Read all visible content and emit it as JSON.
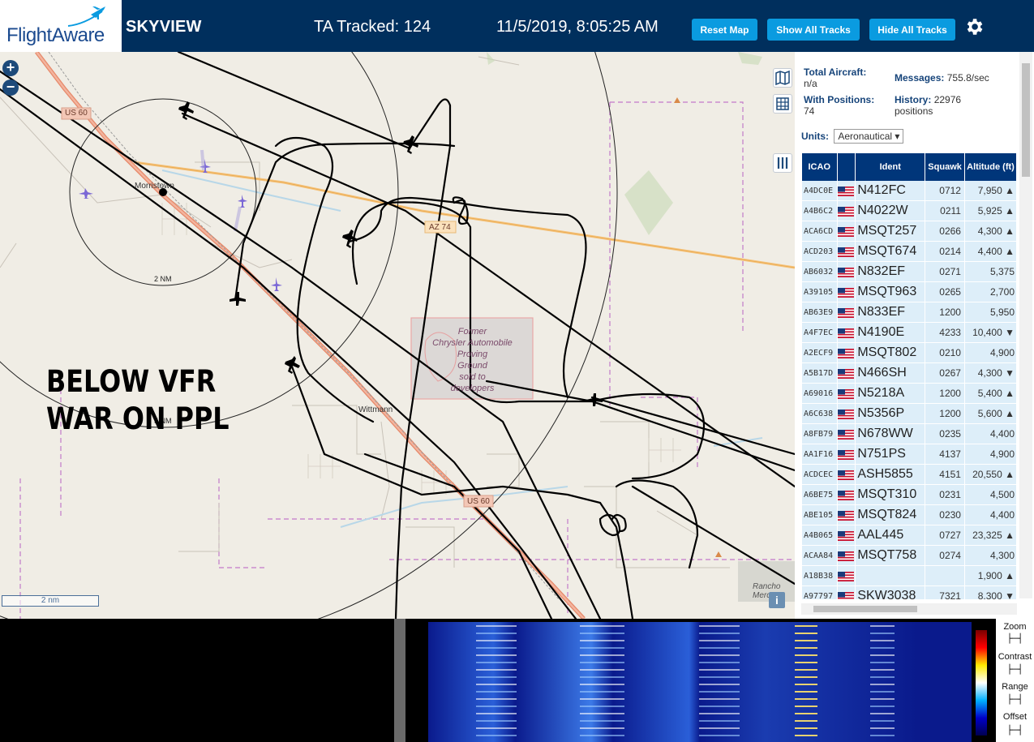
{
  "header": {
    "logo": "FlightAware",
    "app_title": "SKYVIEW",
    "ta_tracked": "TA Tracked: 124",
    "datetime": "11/5/2019, 8:05:25 AM",
    "buttons": {
      "reset_map": "Reset Map",
      "show_all": "Show All Tracks",
      "hide_all": "Hide All Tracks"
    },
    "accent_color": "#0a9be0",
    "bar_color": "#002f5d"
  },
  "map": {
    "labels": {
      "us60_top": "US 60",
      "us60_bottom": "US 60",
      "az74": "AZ 74",
      "morristown": "Morristown",
      "wittmann": "Wittmann",
      "range_2nm": "2 NM",
      "range_5nm": "5 NM",
      "proving_ground": [
        "Former",
        "Chrysler Automobile",
        "Proving",
        "Ground",
        "sold to",
        "developers"
      ],
      "rancho": [
        "Rancho",
        "Merca"
      ]
    },
    "overlay_text": [
      "BELOW VFR",
      "WAR ON PPL"
    ],
    "scale_label": "2 nm",
    "zoom_in": "+",
    "zoom_out": "−",
    "info": "i"
  },
  "sidebar": {
    "total_aircraft_label": "Total Aircraft:",
    "total_aircraft_value": "n/a",
    "with_positions_label": "With Positions:",
    "with_positions_value": "74",
    "messages_label": "Messages:",
    "messages_value": "755.8/sec",
    "history_label": "History:",
    "history_value": "22976",
    "history_unit": "positions",
    "units_label": "Units:",
    "units_value": "Aeronautical",
    "columns": [
      "ICAO",
      "",
      "Ident",
      "Squawk",
      "Altitude (ft)"
    ],
    "rows": [
      {
        "icao": "A4DC0E",
        "ident": "N412FC",
        "squawk": "0712",
        "alt": "7,950",
        "trend": "▲"
      },
      {
        "icao": "A4B6C2",
        "ident": "N4022W",
        "squawk": "0211",
        "alt": "5,925",
        "trend": "▲"
      },
      {
        "icao": "ACA6CD",
        "ident": "MSQT257",
        "squawk": "0266",
        "alt": "4,300",
        "trend": "▲"
      },
      {
        "icao": "ACD203",
        "ident": "MSQT674",
        "squawk": "0214",
        "alt": "4,400",
        "trend": "▲"
      },
      {
        "icao": "AB6032",
        "ident": "N832EF",
        "squawk": "0271",
        "alt": "5,375",
        "trend": ""
      },
      {
        "icao": "A39105",
        "ident": "MSQT963",
        "squawk": "0265",
        "alt": "2,700",
        "trend": ""
      },
      {
        "icao": "AB63E9",
        "ident": "N833EF",
        "squawk": "1200",
        "alt": "5,950",
        "trend": ""
      },
      {
        "icao": "A4F7EC",
        "ident": "N4190E",
        "squawk": "4233",
        "alt": "10,400",
        "trend": "▼"
      },
      {
        "icao": "A2ECF9",
        "ident": "MSQT802",
        "squawk": "0210",
        "alt": "4,900",
        "trend": ""
      },
      {
        "icao": "A5B17D",
        "ident": "N466SH",
        "squawk": "0267",
        "alt": "4,300",
        "trend": "▼"
      },
      {
        "icao": "A69016",
        "ident": "N5218A",
        "squawk": "1200",
        "alt": "5,400",
        "trend": "▲"
      },
      {
        "icao": "A6C638",
        "ident": "N5356P",
        "squawk": "1200",
        "alt": "5,600",
        "trend": "▲"
      },
      {
        "icao": "A8FB79",
        "ident": "N678WW",
        "squawk": "0235",
        "alt": "4,400",
        "trend": ""
      },
      {
        "icao": "AA1F16",
        "ident": "N751PS",
        "squawk": "4137",
        "alt": "4,900",
        "trend": ""
      },
      {
        "icao": "ACDCEC",
        "ident": "ASH5855",
        "squawk": "4151",
        "alt": "20,550",
        "trend": "▲"
      },
      {
        "icao": "A6BE75",
        "ident": "MSQT310",
        "squawk": "0231",
        "alt": "4,500",
        "trend": ""
      },
      {
        "icao": "ABE105",
        "ident": "MSQT824",
        "squawk": "0230",
        "alt": "4,400",
        "trend": ""
      },
      {
        "icao": "A4B065",
        "ident": "AAL445",
        "squawk": "0727",
        "alt": "23,325",
        "trend": "▲"
      },
      {
        "icao": "ACAA84",
        "ident": "MSQT758",
        "squawk": "0274",
        "alt": "4,300",
        "trend": ""
      },
      {
        "icao": "A18B38",
        "ident": "",
        "squawk": "",
        "alt": "1,900",
        "trend": "▲"
      },
      {
        "icao": "A97797",
        "ident": "SKW3038",
        "squawk": "7321",
        "alt": "8,300",
        "trend": "▼"
      }
    ]
  },
  "waterfall": {
    "controls": [
      "Zoom",
      "Contrast",
      "Range",
      "Offset"
    ]
  }
}
